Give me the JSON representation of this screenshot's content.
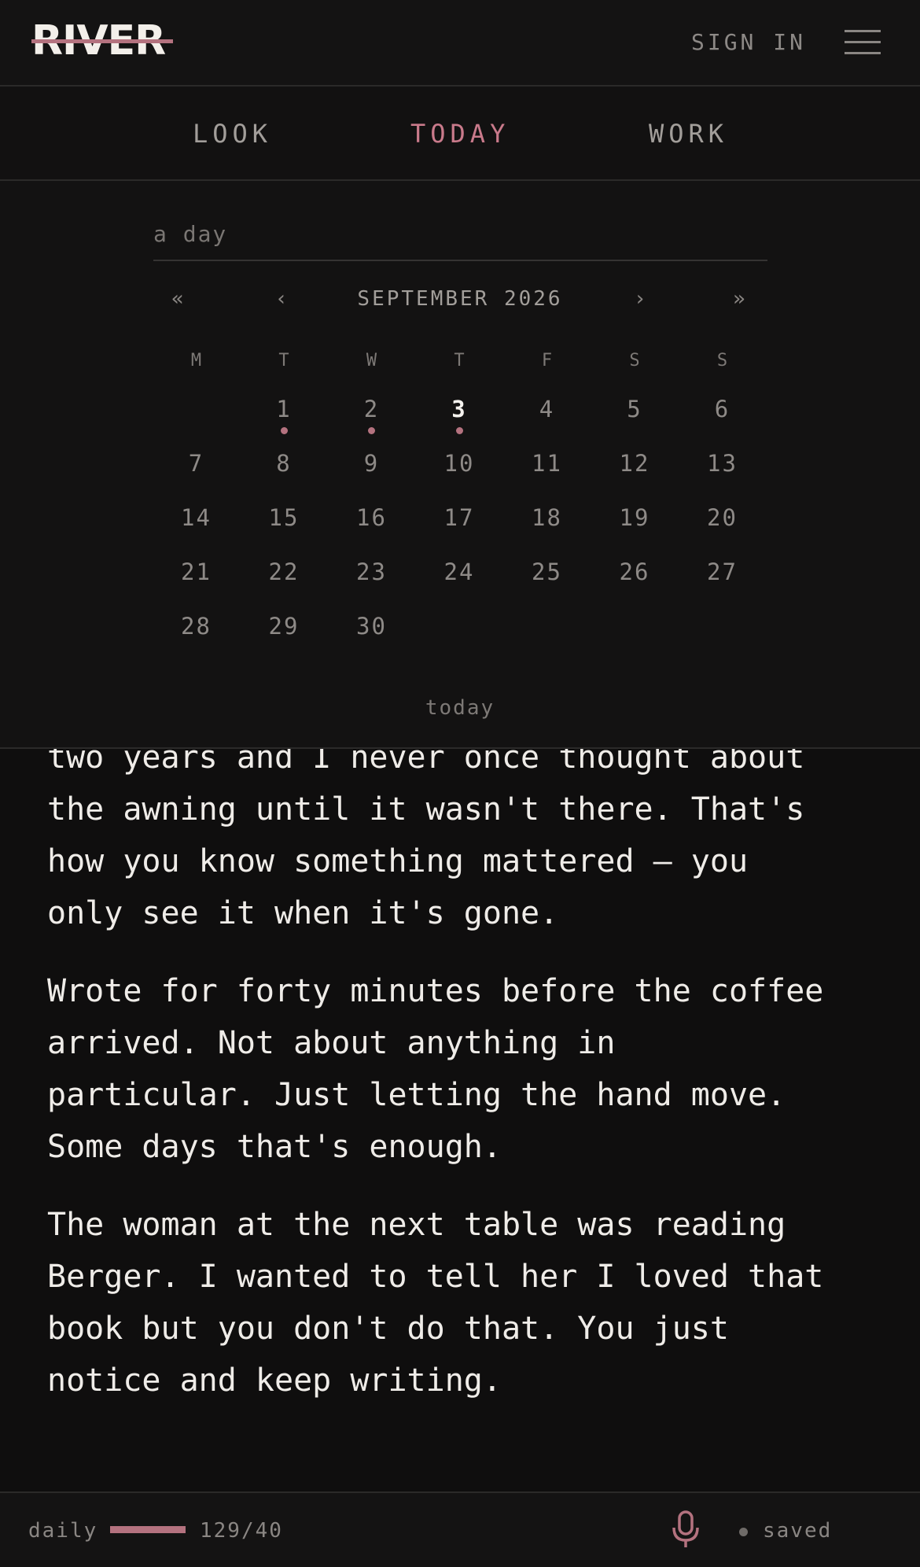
{
  "header": {
    "logo_text": "RIVER",
    "sign_in_label": "SIGN IN",
    "menu_icon": "hamburger-menu-icon"
  },
  "tabs": [
    {
      "label": "LOOK",
      "active": false
    },
    {
      "label": "TODAY",
      "active": true
    },
    {
      "label": "WORK",
      "active": false
    }
  ],
  "picker": {
    "input_placeholder": "a day",
    "input_value": "",
    "prev_year": "«",
    "prev_month": "‹",
    "month_title": "SEPTEMBER 2026",
    "next_month": "›",
    "next_year": "»",
    "weekdays": [
      "M",
      "T",
      "W",
      "T",
      "F",
      "S",
      "S"
    ],
    "weeks": [
      [
        "",
        "1",
        "2",
        "3",
        "4",
        "5",
        "6"
      ],
      [
        "7",
        "8",
        "9",
        "10",
        "11",
        "12",
        "13"
      ],
      [
        "14",
        "15",
        "16",
        "17",
        "18",
        "19",
        "20"
      ],
      [
        "21",
        "22",
        "23",
        "24",
        "25",
        "26",
        "27"
      ],
      [
        "28",
        "29",
        "30",
        "",
        "",
        "",
        ""
      ]
    ],
    "today_day": "3",
    "days_with_entries": [
      "1",
      "2",
      "3"
    ],
    "today_link": "today"
  },
  "entry": {
    "paragraphs": [
      "two years and I never once thought about\nthe awning until it wasn't there. That's\nhow you know something mattered — you\nonly see it when it's gone.",
      "Wrote for forty minutes before the coffee\narrived. Not about anything in\nparticular. Just letting the hand move.\nSome days that's enough.",
      "The woman at the next table was reading\nBerger. I wanted to tell her I loved that\nbook but you don't do that. You just\nnotice and keep writing."
    ]
  },
  "footer": {
    "mode_label": "daily",
    "progress_fraction": 1.0,
    "word_count": "129/40",
    "mic_icon": "microphone-icon",
    "saved_label": "saved"
  },
  "colors": {
    "accent": "#b4727f",
    "active_tab": "#c97a8b",
    "background": "#0f0e0e",
    "text": "#efece8",
    "muted": "#8a8683"
  }
}
